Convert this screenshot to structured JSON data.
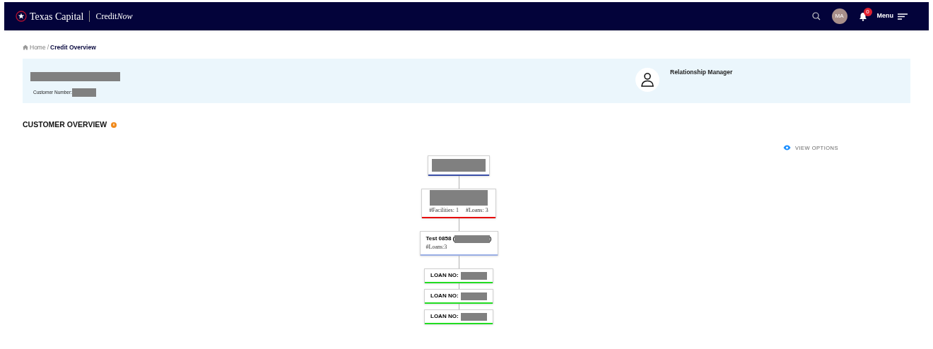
{
  "header": {
    "brand": "Texas Capital",
    "product": "Credit",
    "product_italic": "Now",
    "avatar": "MA",
    "notification_count": "0",
    "menu": "Menu"
  },
  "breadcrumb": [
    {
      "label": "Home",
      "current": false
    },
    {
      "separator": "/",
      "label": "Credit Overview",
      "current": true
    }
  ],
  "customer": {
    "number_label": "Customer Number:",
    "manager_label": "Relationship Manager"
  },
  "section": {
    "title": "CUSTOMER OVERVIEW",
    "view_options": "VIEW OPTIONS"
  },
  "tree": {
    "color": "#3b4fa8",
    "children": [
      {
        "color": "#e60000",
        "lines": [
          "#Facilities: 1",
          "#Loans: 3"
        ],
        "children": [
          {
            "color": "#9aaee6",
            "title": "Test 0858 (",
            "title_end": ")",
            "lines": [
              "#Loans:3"
            ],
            "children": [
              {
                "color": "#22dd22",
                "label": "LOAN NO:"
              },
              {
                "color": "#22dd22",
                "label": "LOAN NO:"
              },
              {
                "color": "#22dd22",
                "label": "LOAN NO:"
              }
            ]
          }
        ]
      }
    ]
  }
}
